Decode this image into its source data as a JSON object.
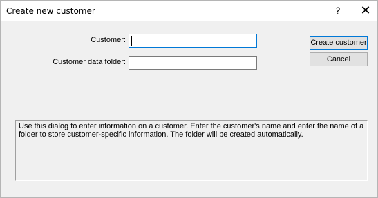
{
  "window": {
    "title": "Create new customer",
    "help_glyph": "?",
    "close_glyph": "✕"
  },
  "form": {
    "customer_label": "Customer:",
    "customer_value": "",
    "folder_label": "Customer data folder:",
    "folder_value": ""
  },
  "buttons": {
    "create_label": "Create customer",
    "cancel_label": "Cancel"
  },
  "info": {
    "text": "Use this dialog to enter information on a customer. Enter the customer's name and enter the name of a folder to store customer-specific information. The folder will be created automatically."
  },
  "colors": {
    "focus_border": "#0078d7",
    "dialog_bg": "#f0f0f0"
  }
}
